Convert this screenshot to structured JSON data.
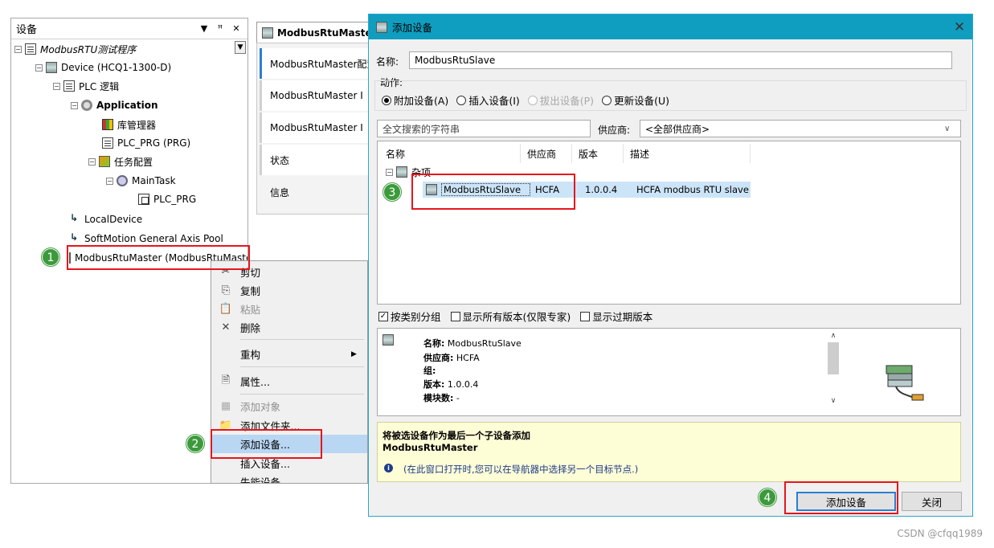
{
  "tree": {
    "title": "设备",
    "header_icons": [
      "▼",
      "ꟸ",
      "✕"
    ],
    "items": [
      {
        "label": "ModbusRTU测试程序"
      },
      {
        "label": "Device (HCQ1-1300-D)"
      },
      {
        "label": "PLC 逻辑"
      },
      {
        "label": "Application"
      },
      {
        "label": "库管理器"
      },
      {
        "label": "PLC_PRG (PRG)"
      },
      {
        "label": "任务配置"
      },
      {
        "label": "MainTask"
      },
      {
        "label": "PLC_PRG"
      },
      {
        "label": "LocalDevice"
      },
      {
        "label": "SoftMotion General Axis Pool"
      },
      {
        "label": "ModbusRtuMaster (ModbusRtuMaster)"
      }
    ]
  },
  "editor": {
    "tab_label": "ModbusRtuMaster",
    "items": [
      "ModbusRtuMaster配置",
      "ModbusRtuMaster I",
      "ModbusRtuMaster I",
      "状态",
      "信息"
    ]
  },
  "context_menu": {
    "items": [
      {
        "label": "剪切",
        "icon": "✂"
      },
      {
        "label": "复制",
        "icon": "⎘"
      },
      {
        "label": "粘贴",
        "icon": "📋"
      },
      {
        "label": "删除",
        "icon": "✕"
      },
      {
        "label": "重构",
        "icon": ""
      },
      {
        "label": "属性...",
        "icon": "🗎"
      },
      {
        "label": "添加对象",
        "icon": "▦"
      },
      {
        "label": "添加文件夹...",
        "icon": "📁"
      },
      {
        "label": "添加设备...",
        "icon": ""
      },
      {
        "label": "插入设备...",
        "icon": ""
      },
      {
        "label": "失能设备",
        "icon": ""
      }
    ]
  },
  "dialog": {
    "title": "添加设备",
    "close_icon": "✕",
    "name_label": "名称:",
    "name_value": "ModbusRtuSlave",
    "action_label": "动作:",
    "actions": [
      "附加设备(A)",
      "插入设备(I)",
      "拔出设备(P)",
      "更新设备(U)"
    ],
    "search_placeholder": "全文搜索的字符串",
    "vendor_label": "供应商:",
    "vendor_value": "<全部供应商>",
    "columns": [
      "名称",
      "供应商",
      "版本",
      "描述"
    ],
    "group_label": "杂项",
    "row": {
      "name": "ModbusRtuSlave",
      "vendor": "HCFA",
      "version": "1.0.0.4",
      "description": "HCFA modbus RTU slave"
    },
    "checkboxes": [
      {
        "label": "按类别分组",
        "checked": true
      },
      {
        "label": "显示所有版本(仅限专家)",
        "checked": false
      },
      {
        "label": "显示过期版本",
        "checked": false
      }
    ],
    "info": {
      "name_k": "名称:",
      "name_v": "ModbusRtuSlave",
      "vendor_k": "供应商:",
      "vendor_v": "HCFA",
      "group_k": "组:",
      "version_k": "版本:",
      "version_v": "1.0.0.4",
      "modules_k": "模块数:",
      "modules_v": "-"
    },
    "hint_title": "将被选设备作为最后一个子设备添加",
    "hint_target": "ModbusRtuMaster",
    "hint_note": "(在此窗口打开时,您可以在导航器中选择另一个目标节点.)",
    "add_button": "添加设备",
    "close_button": "关闭"
  },
  "badges": [
    "1",
    "2",
    "3",
    "4"
  ],
  "watermark": "CSDN @cfqq1989",
  "colors": {
    "accent": "#0f9ec0",
    "highlight": "#b9d6f2",
    "annotation": "#e6161c",
    "badge": "#3c9a3c"
  }
}
